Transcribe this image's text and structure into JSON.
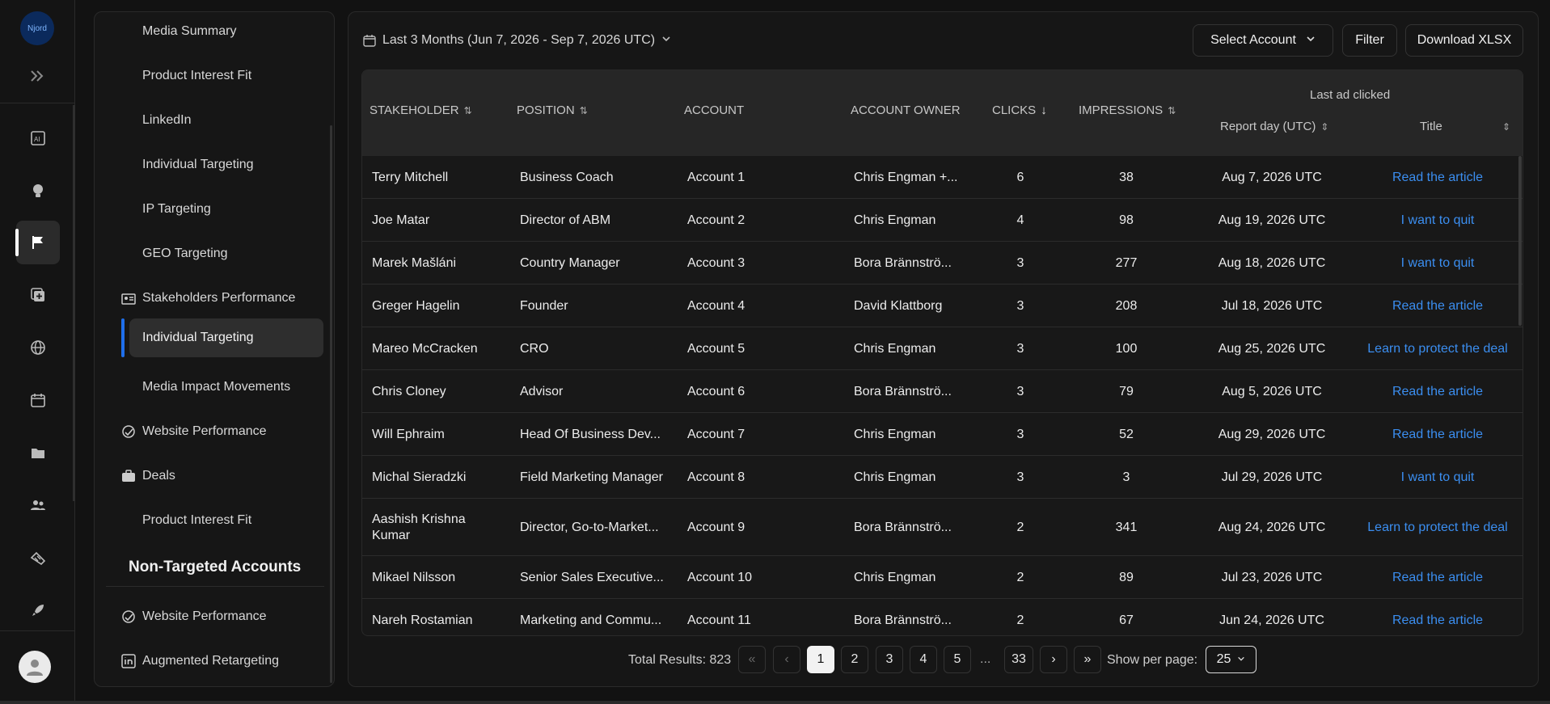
{
  "app": {
    "logo_text": "Njord"
  },
  "rail": {
    "items": [
      "ai-report-icon",
      "bulb-icon",
      "flag-icon",
      "copy-plus-icon",
      "globe-icon",
      "calendar-icon",
      "folder-icon",
      "users-icon",
      "handshake-icon",
      "rocket-icon"
    ],
    "active": "flag-icon"
  },
  "nav": {
    "items": [
      {
        "label": "Media Summary",
        "type": "sub"
      },
      {
        "label": "Product Interest Fit",
        "type": "sub"
      },
      {
        "label": "LinkedIn",
        "type": "sub"
      },
      {
        "label": "Individual Targeting",
        "type": "sub"
      },
      {
        "label": "IP Targeting",
        "type": "sub"
      },
      {
        "label": "GEO Targeting",
        "type": "sub"
      },
      {
        "label": "Stakeholders Performance",
        "type": "head",
        "icon": "stakeholders-icon"
      },
      {
        "label": "Individual Targeting",
        "type": "active"
      },
      {
        "label": "Media Impact Movements",
        "type": "sub"
      },
      {
        "label": "Website Performance",
        "type": "head",
        "icon": "website-performance-icon"
      },
      {
        "label": "Deals",
        "type": "head",
        "icon": "briefcase-icon"
      },
      {
        "label": "Product Interest Fit",
        "type": "sub"
      }
    ],
    "section_title": "Non-Targeted Accounts",
    "section_items": [
      {
        "label": "Website Performance",
        "icon": "website-performance-icon"
      },
      {
        "label": "Augmented Retargeting",
        "icon": "linkedin-icon"
      }
    ]
  },
  "toolbar": {
    "date_range": "Last 3 Months (Jun 7, 2026 - Sep 7, 2026 UTC)",
    "select_account": "Select Account",
    "filter": "Filter",
    "download": "Download XLSX"
  },
  "table": {
    "headers": {
      "stakeholder": "STAKEHOLDER",
      "position": "POSITION",
      "account": "ACCOUNT",
      "account_owner": "ACCOUNT OWNER",
      "clicks": "CLICKS",
      "impressions": "IMPRESSIONS",
      "last_ad_clicked": "Last ad clicked",
      "report_day": "Report day (UTC)",
      "title": "Title"
    },
    "rows": [
      {
        "stakeholder": "Terry Mitchell",
        "position": "Business Coach",
        "account": "Account 1",
        "owner": "Chris Engman +...",
        "clicks": "6",
        "impressions": "38",
        "report_day": "Aug 7, 2026 UTC",
        "title": "Read the article"
      },
      {
        "stakeholder": "Joe Matar",
        "position": "Director of ABM",
        "account": "Account 2",
        "owner": "Chris Engman",
        "clicks": "4",
        "impressions": "98",
        "report_day": "Aug 19, 2026 UTC",
        "title": "I want to quit"
      },
      {
        "stakeholder": "Marek Mašláni",
        "position": "Country Manager",
        "account": "Account 3",
        "owner": "Bora Brännströ...",
        "clicks": "3",
        "impressions": "277",
        "report_day": "Aug 18, 2026 UTC",
        "title": "I want to quit"
      },
      {
        "stakeholder": "Greger Hagelin",
        "position": "Founder",
        "account": "Account 4",
        "owner": "David Klattborg",
        "clicks": "3",
        "impressions": "208",
        "report_day": "Jul 18, 2026 UTC",
        "title": "Read the article"
      },
      {
        "stakeholder": "Mareo McCracken",
        "position": "CRO",
        "account": "Account 5",
        "owner": "Chris Engman",
        "clicks": "3",
        "impressions": "100",
        "report_day": "Aug 25, 2026 UTC",
        "title": "Learn to protect the deal"
      },
      {
        "stakeholder": "Chris Cloney",
        "position": "Advisor",
        "account": "Account 6",
        "owner": "Bora Brännströ...",
        "clicks": "3",
        "impressions": "79",
        "report_day": "Aug 5, 2026 UTC",
        "title": "Read the article"
      },
      {
        "stakeholder": "Will Ephraim",
        "position": "Head Of Business Dev...",
        "account": "Account 7",
        "owner": "Chris Engman",
        "clicks": "3",
        "impressions": "52",
        "report_day": "Aug 29, 2026 UTC",
        "title": "Read the article"
      },
      {
        "stakeholder": "Michal Sieradzki",
        "position": "Field Marketing Manager",
        "account": "Account 8",
        "owner": "Chris Engman",
        "clicks": "3",
        "impressions": "3",
        "report_day": "Jul 29, 2026 UTC",
        "title": "I want to quit"
      },
      {
        "stakeholder": "Aashish Krishna Kumar",
        "position": "Director, Go-to-Market...",
        "account": "Account 9",
        "owner": "Bora Brännströ...",
        "clicks": "2",
        "impressions": "341",
        "report_day": "Aug 24, 2026 UTC",
        "title": "Learn to protect the deal"
      },
      {
        "stakeholder": "Mikael Nilsson",
        "position": "Senior Sales Executive...",
        "account": "Account 10",
        "owner": "Chris Engman",
        "clicks": "2",
        "impressions": "89",
        "report_day": "Jul 23, 2026 UTC",
        "title": "Read the article"
      },
      {
        "stakeholder": "Nareh Rostamian",
        "position": "Marketing and Commu...",
        "account": "Account 11",
        "owner": "Bora Brännströ...",
        "clicks": "2",
        "impressions": "67",
        "report_day": "Jun 24, 2026 UTC",
        "title": "Read the article"
      }
    ]
  },
  "pagination": {
    "total_label": "Total Results: 823",
    "pages": [
      "1",
      "2",
      "3",
      "4",
      "5"
    ],
    "ellipsis": "...",
    "last_page": "33",
    "current": "1",
    "per_page_label": "Show per page:",
    "per_page": "25"
  }
}
